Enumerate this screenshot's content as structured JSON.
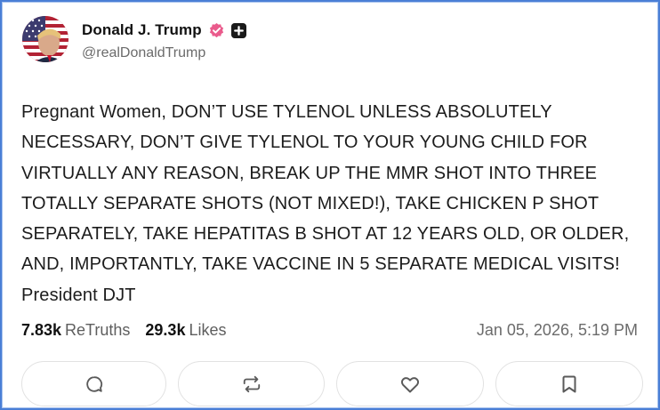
{
  "author": {
    "display_name": "Donald J. Trump",
    "handle": "@realDonaldTrump",
    "verified_badge_icon": "verified-badge-icon",
    "extra_badge_icon": "plus-badge-icon",
    "verified_color": "#ea5b8c"
  },
  "post": {
    "text": "Pregnant Women, DON’T USE TYLENOL UNLESS ABSOLUTELY NECESSARY, DON’T GIVE TYLENOL TO YOUR YOUNG CHILD FOR VIRTUALLY ANY REASON, BREAK UP THE MMR SHOT INTO THREE TOTALLY SEPARATE SHOTS (NOT MIXED!), TAKE CHICKEN P SHOT SEPARATELY, TAKE HEPATITAS B SHOT AT 12 YEARS OLD, OR OLDER, AND, IMPORTANTLY, TAKE VACCINE IN 5 SEPARATE MEDICAL VISITS! President DJT"
  },
  "stats": {
    "retruths_count": "7.83k",
    "retruths_label": "ReTruths",
    "likes_count": "29.3k",
    "likes_label": "Likes",
    "timestamp": "Jan 05, 2026, 5:19 PM"
  },
  "actions": [
    {
      "icon": "reply-icon"
    },
    {
      "icon": "retruth-icon"
    },
    {
      "icon": "like-icon"
    },
    {
      "icon": "bookmark-icon"
    }
  ]
}
